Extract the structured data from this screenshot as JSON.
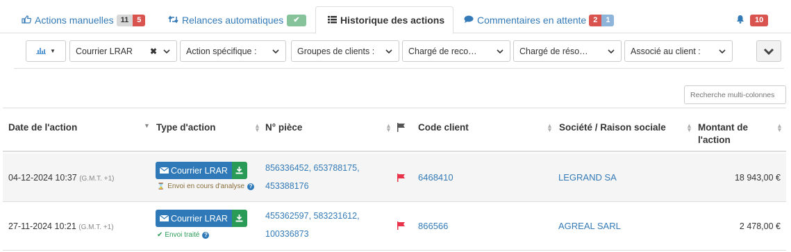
{
  "tabs": {
    "actions_manuelles": {
      "label": "Actions manuelles",
      "count_a": "11",
      "count_b": "5"
    },
    "relances": {
      "label": "Relances automatiques"
    },
    "historique": {
      "label": "Historique des actions"
    },
    "commentaires": {
      "label": "Commentaires en attente",
      "count_a": "2",
      "count_b": "1"
    },
    "notifications": {
      "count": "10"
    }
  },
  "filters": {
    "type": "Courrier LRAR",
    "action_specifique": "Action spécifique :",
    "groupes": "Groupes de clients :",
    "charge_reco": "Chargé de reco…",
    "charge_reso": "Chargé de réso…",
    "associe": "Associé au client :"
  },
  "search": {
    "placeholder": "Recherche multi-colonnes"
  },
  "table": {
    "headers": {
      "date": "Date de l'action",
      "type": "Type d'action",
      "piece": "N° pièce",
      "code": "Code client",
      "societe": "Société / Raison sociale",
      "montant_l1": "Montant de",
      "montant_l2": "l'action"
    },
    "rows": [
      {
        "date": "04-12-2024 10:37",
        "tz": "(G.M.T. +1)",
        "action": "Courrier LRAR",
        "status": "Envoi en cours d'analyse",
        "pieces_l1": "856336452, 653788175,",
        "pieces_l2": "453388176",
        "code": "6468410",
        "societe": "LEGRAND SA",
        "montant": "18 943,00 €"
      },
      {
        "date": "27-11-2024 10:21",
        "tz": "(G.M.T. +1)",
        "action": "Courrier LRAR",
        "status": "Envoi traité",
        "pieces_l1": "455362597, 583231612,",
        "pieces_l2": "100336873",
        "code": "866566",
        "societe": "AGREAL SARL",
        "montant": "2 478,00 €"
      }
    ]
  },
  "icons": {
    "hand": "hand-pointer-icon",
    "retweet": "retweet-icon",
    "list": "list-icon",
    "comment": "comment-icon",
    "bell": "bell-icon",
    "chart": "bar-chart-icon",
    "flag": "flag-icon",
    "envelope": "envelope-icon",
    "download": "download-icon",
    "hourglass": "hourglass-icon",
    "check": "check-icon",
    "question": "question-circle-icon"
  },
  "colors": {
    "link": "#337ab7",
    "primary": "#2f79b9",
    "success": "#2a9b57",
    "danger": "#d9534f",
    "flag": "#e8334a",
    "status_pending": "#8a6d3b",
    "status_done": "#2a9b57"
  }
}
